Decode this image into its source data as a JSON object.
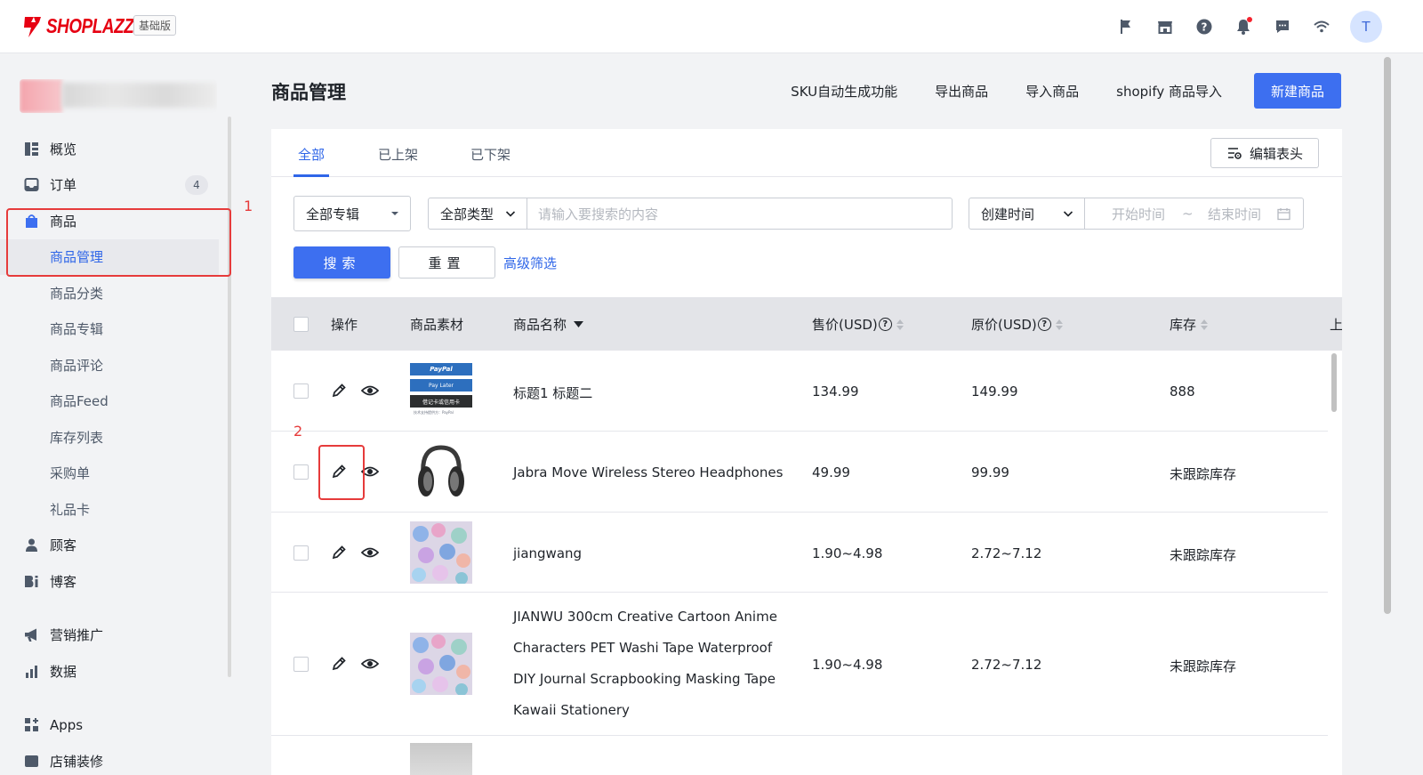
{
  "brand": {
    "logo_text": "SHOPLAZZA",
    "edition": "基础版",
    "accent": "#e60012"
  },
  "topbar": {
    "icons": [
      "flag-icon",
      "store-icon",
      "help-icon",
      "bell-icon",
      "chat-icon",
      "wifi-icon"
    ],
    "avatar_letter": "T"
  },
  "sidebar": {
    "items": [
      {
        "label": "概览",
        "icon": "dashboard-icon"
      },
      {
        "label": "订单",
        "icon": "inbox-icon",
        "badge": "4"
      },
      {
        "label": "商品",
        "icon": "bag-icon"
      },
      {
        "label": "商品管理"
      },
      {
        "label": "商品分类"
      },
      {
        "label": "商品专辑"
      },
      {
        "label": "商品评论"
      },
      {
        "label": "商品Feed"
      },
      {
        "label": "库存列表"
      },
      {
        "label": "采购单"
      },
      {
        "label": "礼品卡"
      },
      {
        "label": "顾客",
        "icon": "user-icon"
      },
      {
        "label": "博客",
        "icon": "blog-icon"
      },
      {
        "label": "营销推广",
        "icon": "megaphone-icon"
      },
      {
        "label": "数据",
        "icon": "bar-chart-icon"
      },
      {
        "label": "Apps",
        "icon": "apps-icon"
      },
      {
        "label": "店铺装修",
        "icon": "theme-icon"
      }
    ]
  },
  "annotations": {
    "one": "1",
    "two": "2"
  },
  "page": {
    "title": "商品管理",
    "actions": [
      "SKU自动生成功能",
      "导出商品",
      "导入商品",
      "shopify 商品导入"
    ],
    "primary_action": "新建商品"
  },
  "tabs": [
    "全部",
    "已上架",
    "已下架"
  ],
  "edit_header_label": "编辑表头",
  "filters": {
    "collection": "全部专辑",
    "type": "全部类型",
    "search_placeholder": "请输入要搜索的内容",
    "time_field": "创建时间",
    "start_placeholder": "开始时间",
    "range_sep": "~",
    "end_placeholder": "结束时间",
    "search_button": "搜索",
    "reset_button": "重置",
    "advanced": "高级筛选"
  },
  "table": {
    "headers": {
      "ops": "操作",
      "media": "商品素材",
      "name": "商品名称",
      "price": "售价(USD)",
      "compare": "原价(USD)",
      "stock": "库存",
      "more": "上"
    },
    "rows": [
      {
        "name": "标题1 标题二",
        "price": "134.99",
        "compare": "149.99",
        "stock": "888",
        "thumb": "paypal"
      },
      {
        "name": "Jabra Move Wireless Stereo Headphones",
        "price": "49.99",
        "compare": "99.99",
        "stock": "未跟踪库存",
        "thumb": "headphones"
      },
      {
        "name": "jiangwang",
        "price": "1.90~4.98",
        "compare": "2.72~7.12",
        "stock": "未跟踪库存",
        "thumb": "stickers"
      },
      {
        "name_lines": [
          "JIANWU 300cm Creative Cartoon Anime",
          "Characters PET Washi Tape Waterproof",
          "DIY Journal Scrapbooking Masking Tape",
          "Kawaii Stationery"
        ],
        "price": "1.90~4.98",
        "compare": "2.72~7.12",
        "stock": "未跟踪库存",
        "thumb": "stickers"
      }
    ],
    "paypal_thumb": {
      "line1": "PayPal",
      "line2": "Pay Later",
      "line3": "借记卡或信用卡",
      "foot": "技术支持提供方：PayPal"
    }
  }
}
